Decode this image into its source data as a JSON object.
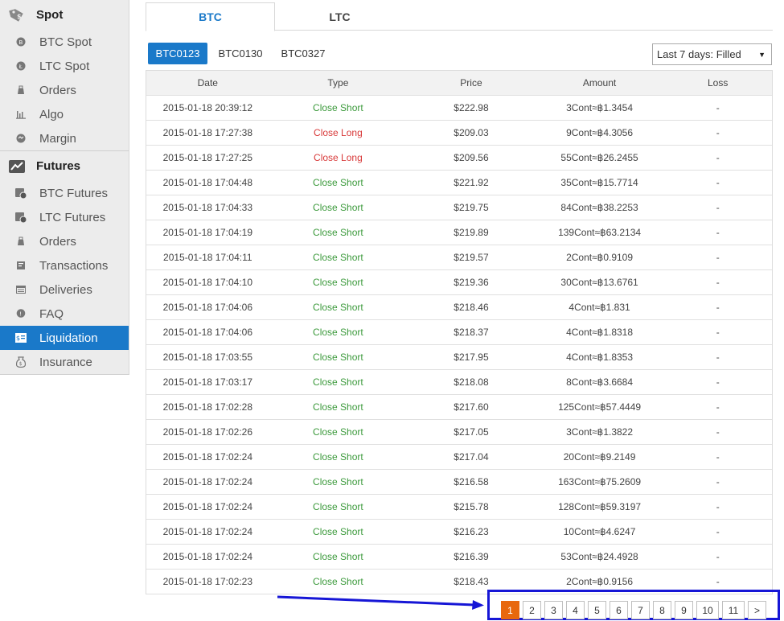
{
  "sidebar": {
    "spot": {
      "label": "Spot",
      "items": [
        {
          "label": "BTC Spot",
          "icon": "btc-coin-icon"
        },
        {
          "label": "LTC Spot",
          "icon": "ltc-coin-icon"
        },
        {
          "label": "Orders",
          "icon": "orders-icon"
        },
        {
          "label": "Algo",
          "icon": "bar-chart-icon"
        },
        {
          "label": "Margin",
          "icon": "margin-icon"
        }
      ]
    },
    "futures": {
      "label": "Futures",
      "items": [
        {
          "label": "BTC Futures",
          "icon": "btc-futures-icon"
        },
        {
          "label": "LTC Futures",
          "icon": "ltc-futures-icon"
        },
        {
          "label": "Orders",
          "icon": "orders-icon"
        },
        {
          "label": "Transactions",
          "icon": "transactions-icon"
        },
        {
          "label": "Deliveries",
          "icon": "deliveries-icon"
        },
        {
          "label": "FAQ",
          "icon": "faq-icon"
        },
        {
          "label": "Liquidation",
          "icon": "liquidation-icon",
          "active": true
        },
        {
          "label": "Insurance",
          "icon": "insurance-icon"
        }
      ]
    }
  },
  "tabs": [
    {
      "label": "BTC",
      "active": true
    },
    {
      "label": "LTC",
      "active": false
    }
  ],
  "contracts": [
    {
      "label": "BTC0123",
      "active": true
    },
    {
      "label": "BTC0130",
      "active": false
    },
    {
      "label": "BTC0327",
      "active": false
    }
  ],
  "filter": {
    "value": "Last 7 days: Filled"
  },
  "table": {
    "headers": [
      "Date",
      "Type",
      "Price",
      "Amount",
      "Loss"
    ],
    "rows": [
      {
        "date": "2015-01-18 20:39:12",
        "type": "Close Short",
        "price": "$222.98",
        "amount": "3Cont≈฿1.3454",
        "loss": "-"
      },
      {
        "date": "2015-01-18 17:27:38",
        "type": "Close Long",
        "price": "$209.03",
        "amount": "9Cont≈฿4.3056",
        "loss": "-"
      },
      {
        "date": "2015-01-18 17:27:25",
        "type": "Close Long",
        "price": "$209.56",
        "amount": "55Cont≈฿26.2455",
        "loss": "-"
      },
      {
        "date": "2015-01-18 17:04:48",
        "type": "Close Short",
        "price": "$221.92",
        "amount": "35Cont≈฿15.7714",
        "loss": "-"
      },
      {
        "date": "2015-01-18 17:04:33",
        "type": "Close Short",
        "price": "$219.75",
        "amount": "84Cont≈฿38.2253",
        "loss": "-"
      },
      {
        "date": "2015-01-18 17:04:19",
        "type": "Close Short",
        "price": "$219.89",
        "amount": "139Cont≈฿63.2134",
        "loss": "-"
      },
      {
        "date": "2015-01-18 17:04:11",
        "type": "Close Short",
        "price": "$219.57",
        "amount": "2Cont≈฿0.9109",
        "loss": "-"
      },
      {
        "date": "2015-01-18 17:04:10",
        "type": "Close Short",
        "price": "$219.36",
        "amount": "30Cont≈฿13.6761",
        "loss": "-"
      },
      {
        "date": "2015-01-18 17:04:06",
        "type": "Close Short",
        "price": "$218.46",
        "amount": "4Cont≈฿1.831",
        "loss": "-"
      },
      {
        "date": "2015-01-18 17:04:06",
        "type": "Close Short",
        "price": "$218.37",
        "amount": "4Cont≈฿1.8318",
        "loss": "-"
      },
      {
        "date": "2015-01-18 17:03:55",
        "type": "Close Short",
        "price": "$217.95",
        "amount": "4Cont≈฿1.8353",
        "loss": "-"
      },
      {
        "date": "2015-01-18 17:03:17",
        "type": "Close Short",
        "price": "$218.08",
        "amount": "8Cont≈฿3.6684",
        "loss": "-"
      },
      {
        "date": "2015-01-18 17:02:28",
        "type": "Close Short",
        "price": "$217.60",
        "amount": "125Cont≈฿57.4449",
        "loss": "-"
      },
      {
        "date": "2015-01-18 17:02:26",
        "type": "Close Short",
        "price": "$217.05",
        "amount": "3Cont≈฿1.3822",
        "loss": "-"
      },
      {
        "date": "2015-01-18 17:02:24",
        "type": "Close Short",
        "price": "$217.04",
        "amount": "20Cont≈฿9.2149",
        "loss": "-"
      },
      {
        "date": "2015-01-18 17:02:24",
        "type": "Close Short",
        "price": "$216.58",
        "amount": "163Cont≈฿75.2609",
        "loss": "-"
      },
      {
        "date": "2015-01-18 17:02:24",
        "type": "Close Short",
        "price": "$215.78",
        "amount": "128Cont≈฿59.3197",
        "loss": "-"
      },
      {
        "date": "2015-01-18 17:02:24",
        "type": "Close Short",
        "price": "$216.23",
        "amount": "10Cont≈฿4.6247",
        "loss": "-"
      },
      {
        "date": "2015-01-18 17:02:24",
        "type": "Close Short",
        "price": "$216.39",
        "amount": "53Cont≈฿24.4928",
        "loss": "-"
      },
      {
        "date": "2015-01-18 17:02:23",
        "type": "Close Short",
        "price": "$218.43",
        "amount": "2Cont≈฿0.9156",
        "loss": "-"
      }
    ]
  },
  "pagination": {
    "pages": [
      "1",
      "2",
      "3",
      "4",
      "5",
      "6",
      "7",
      "8",
      "9",
      "10",
      "11"
    ],
    "current": "1",
    "next_label": ">"
  },
  "colors": {
    "accent": "#1a79c9",
    "close_short": "#3c9a3c",
    "close_long": "#d83a3a",
    "page_active": "#e8680e",
    "highlight_box": "#1616d6"
  }
}
